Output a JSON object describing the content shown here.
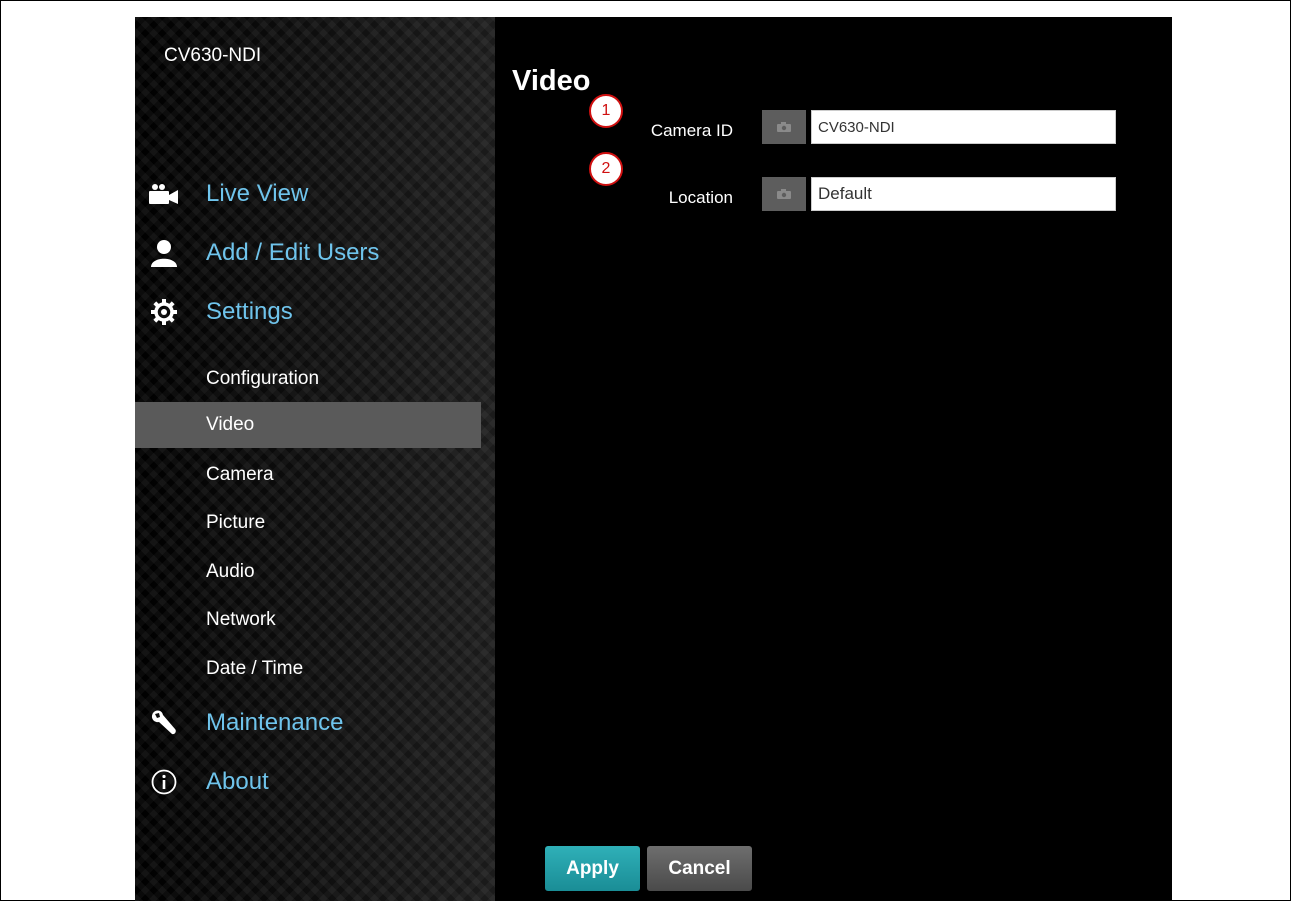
{
  "app": {
    "device_name": "CV630-NDI"
  },
  "sidebar": {
    "main_items": [
      {
        "label": "Live View",
        "icon": "video-camera-icon"
      },
      {
        "label": "Add / Edit Users",
        "icon": "user-icon"
      },
      {
        "label": "Settings",
        "icon": "gear-icon"
      },
      {
        "label": "Maintenance",
        "icon": "wrench-icon"
      },
      {
        "label": "About",
        "icon": "info-icon"
      }
    ],
    "settings_items": [
      {
        "label": "Configuration"
      },
      {
        "label": "Video",
        "active": true
      },
      {
        "label": "Camera"
      },
      {
        "label": "Picture"
      },
      {
        "label": "Audio"
      },
      {
        "label": "Network"
      },
      {
        "label": "Date / Time"
      }
    ]
  },
  "main": {
    "title": "Video",
    "fields": [
      {
        "badge": "1",
        "label": "Camera ID",
        "value": "CV630-NDI"
      },
      {
        "badge": "2",
        "label": "Location",
        "value": "Default"
      }
    ]
  },
  "buttons": {
    "apply": "Apply",
    "cancel": "Cancel"
  },
  "colors": {
    "nav_link": "#6fc4ec",
    "active_item_bg": "#5a5a5a",
    "apply_button": "#1a8d96",
    "cancel_button": "#4a4a4a",
    "annotation_red": "#d01010"
  }
}
